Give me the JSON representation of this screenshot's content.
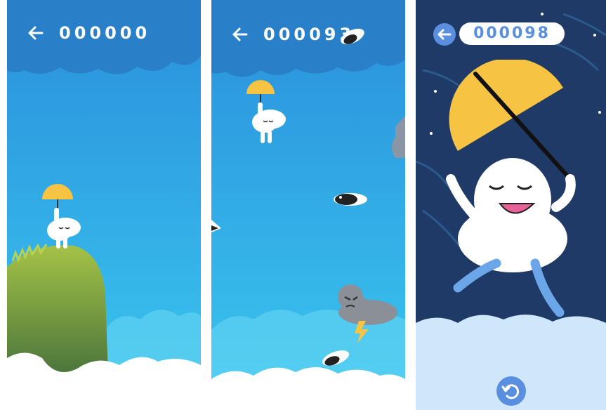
{
  "panels": [
    {
      "id": "start",
      "score": "000000",
      "back_icon": "arrow-left-icon",
      "sprites": [
        "cloud-character-with-umbrella",
        "grassy-hill"
      ]
    },
    {
      "id": "flying",
      "score": "000093",
      "back_icon": "arrow-left-icon",
      "sprites": [
        "cloud-character-with-umbrella",
        "penguin-bird",
        "storm-cloud",
        "lightning-bolt"
      ]
    },
    {
      "id": "game-over",
      "score": "000098",
      "back_icon": "arrow-left-icon",
      "replay_icon": "replay-icon",
      "sprites": [
        "happy-cloud-character-with-umbrella",
        "night-sky",
        "cloud-floor"
      ]
    }
  ],
  "colors": {
    "sky_top": "#2a93dd",
    "sky_bottom": "#34c4ee",
    "night_sky": "#1f3a66",
    "umbrella": "#f6c342",
    "grass": "#7ea83b",
    "score_pill_text": "#5a8fe0"
  }
}
